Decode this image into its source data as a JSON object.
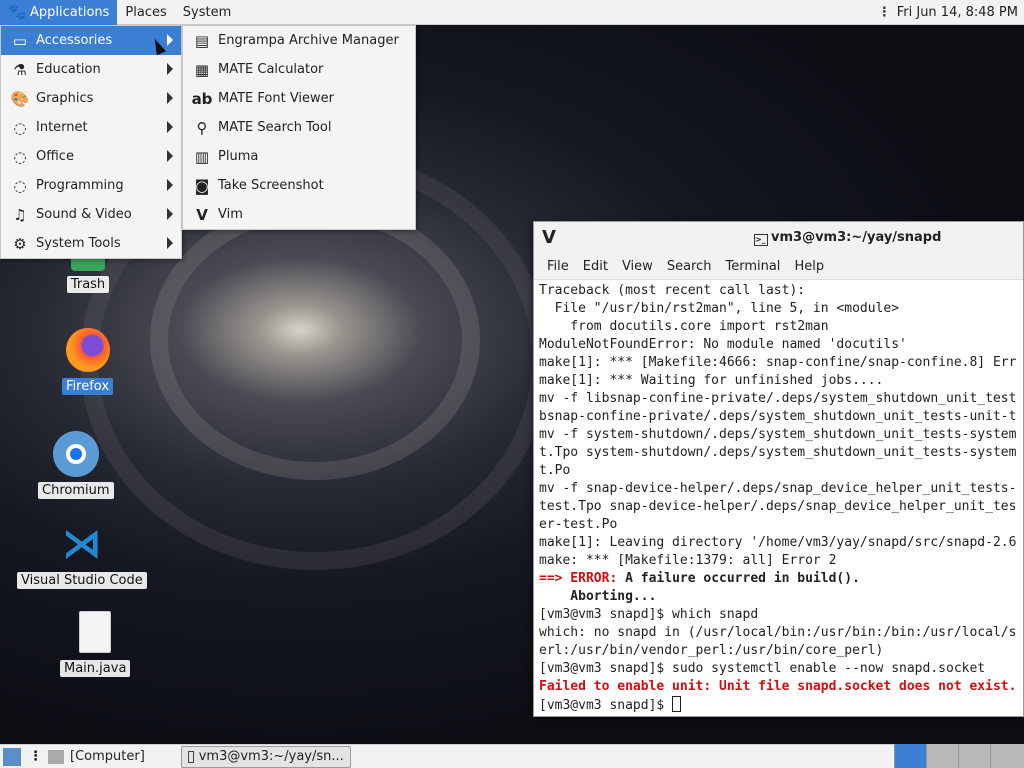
{
  "top_panel": {
    "applications": "Applications",
    "places": "Places",
    "system": "System",
    "clock": "Fri Jun 14,  8:48 PM"
  },
  "app_menu": {
    "categories": [
      {
        "label": "Accessories",
        "icon": "accessories-icon"
      },
      {
        "label": "Education",
        "icon": "education-icon"
      },
      {
        "label": "Graphics",
        "icon": "graphics-icon"
      },
      {
        "label": "Internet",
        "icon": "internet-icon"
      },
      {
        "label": "Office",
        "icon": "office-icon"
      },
      {
        "label": "Programming",
        "icon": "programming-icon"
      },
      {
        "label": "Sound & Video",
        "icon": "sound-video-icon"
      },
      {
        "label": "System Tools",
        "icon": "system-tools-icon"
      }
    ],
    "accessories": [
      {
        "label": "Engrampa Archive Manager",
        "icon": "archive-icon"
      },
      {
        "label": "MATE Calculator",
        "icon": "calculator-icon"
      },
      {
        "label": "MATE Font Viewer",
        "icon": "font-icon"
      },
      {
        "label": "MATE Search Tool",
        "icon": "search-icon"
      },
      {
        "label": "Pluma",
        "icon": "text-editor-icon"
      },
      {
        "label": "Take Screenshot",
        "icon": "camera-icon"
      },
      {
        "label": "Vim",
        "icon": "vim-icon"
      }
    ]
  },
  "desktop": {
    "trash": "Trash",
    "firefox": "Firefox",
    "chromium": "Chromium",
    "vscode": "Visual Studio Code",
    "mainjava": "Main.java"
  },
  "terminal": {
    "title": "vm3@vm3:~/yay/snapd",
    "menu": [
      "File",
      "Edit",
      "View",
      "Search",
      "Terminal",
      "Help"
    ],
    "lines": [
      "Traceback (most recent call last):",
      "  File \"/usr/bin/rst2man\", line 5, in <module>",
      "    from docutils.core import rst2man",
      "ModuleNotFoundError: No module named 'docutils'",
      "make[1]: *** [Makefile:4666: snap-confine/snap-confine.8] Err",
      "make[1]: *** Waiting for unfinished jobs....",
      "mv -f libsnap-confine-private/.deps/system_shutdown_unit_test",
      "bsnap-confine-private/.deps/system_shutdown_unit_tests-unit-t",
      "mv -f system-shutdown/.deps/system_shutdown_unit_tests-system",
      "t.Tpo system-shutdown/.deps/system_shutdown_unit_tests-system",
      "t.Po",
      "mv -f snap-device-helper/.deps/snap_device_helper_unit_tests-",
      "test.Tpo snap-device-helper/.deps/snap_device_helper_unit_tes",
      "er-test.Po",
      "make[1]: Leaving directory '/home/vm3/yay/snapd/src/snapd-2.6",
      "make: *** [Makefile:1379: all] Error 2"
    ],
    "error_arrow": "==> ERROR:",
    "error_msg": " A failure occurred in build().",
    "aborting": "    Aborting...",
    "lines2": [
      "[vm3@vm3 snapd]$ which snapd",
      "which: no snapd in (/usr/local/bin:/usr/bin:/bin:/usr/local/s",
      "erl:/usr/bin/vendor_perl:/usr/bin/core_perl)",
      "[vm3@vm3 snapd]$ sudo systemctl enable --now snapd.socket"
    ],
    "failed": "Failed to enable unit: Unit file snapd.socket does not exist.",
    "prompt": "[vm3@vm3 snapd]$ "
  },
  "bottom_panel": {
    "computer": "[Computer]",
    "task_terminal": "vm3@vm3:~/yay/sn..."
  }
}
